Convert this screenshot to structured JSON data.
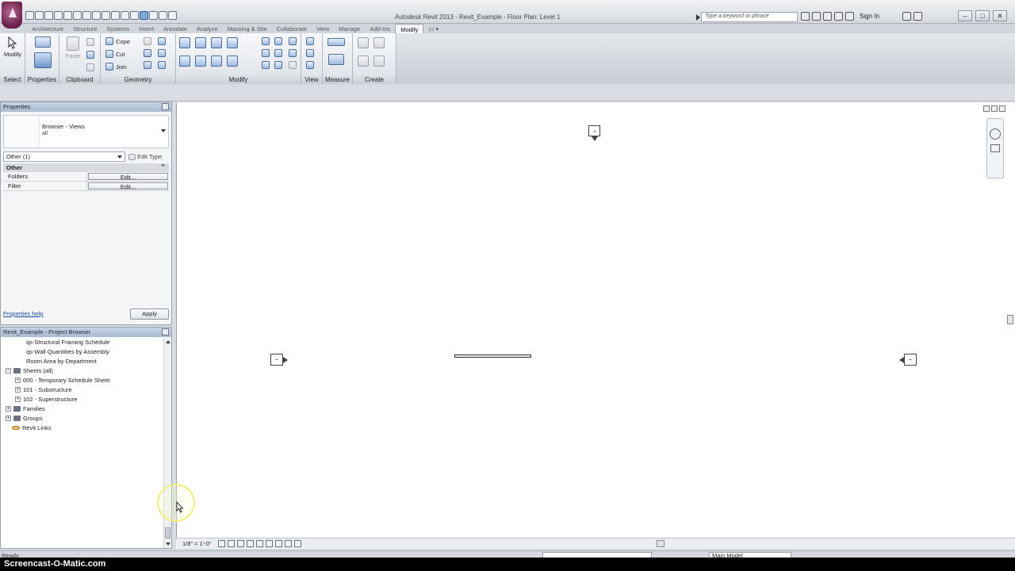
{
  "titlebar": {
    "app_title": "Autodesk Revit 2013",
    "separator": "-",
    "doc_title": "Revit_Example - Floor Plan: Level 1",
    "search_placeholder": "Type a keyword or phrase",
    "sign_in": "Sign In",
    "window_controls": [
      "–",
      "□",
      "✕"
    ]
  },
  "tabs": [
    "Architecture",
    "Structure",
    "Systems",
    "Insert",
    "Annotate",
    "Analyze",
    "Massing & Site",
    "Collaborate",
    "View",
    "Manage",
    "Add-Ins",
    "Modify"
  ],
  "active_tab": "Modify",
  "ribbon": {
    "panels": {
      "select": "Select",
      "properties": "Properties",
      "clipboard": "Clipboard",
      "geometry": "Geometry",
      "modify": "Modify",
      "view": "View",
      "measure": "Measure",
      "create": "Create"
    },
    "buttons": {
      "modify": "Modify",
      "paste": "Paste",
      "cope": "Cope",
      "cut": "Cut",
      "join": "Join"
    }
  },
  "properties": {
    "title": "Properties",
    "type_name": "Browser - Views",
    "type_sub": "all",
    "instance_filter": "Other (1)",
    "edit_type": "Edit Type",
    "group": "Other",
    "rows": [
      {
        "key": "Folders",
        "value": "Edit..."
      },
      {
        "key": "Filter",
        "value": "Edit..."
      }
    ],
    "help_link": "Properties help",
    "apply": "Apply"
  },
  "browser": {
    "title": "Revit_Example - Project Browser",
    "items": [
      {
        "label": "qs-Structural Framing Schedule",
        "kind": "leaf"
      },
      {
        "label": "qs-Wall Quantities by Assembly",
        "kind": "leaf"
      },
      {
        "label": "Room Area by Department",
        "kind": "leaf"
      },
      {
        "label": "Sheets (all)",
        "kind": "folder-open"
      },
      {
        "label": "000 - Temporary Schedule Sheet",
        "kind": "sheet"
      },
      {
        "label": "101 - Substructure",
        "kind": "sheet"
      },
      {
        "label": "102 - Superstructure",
        "kind": "sheet"
      },
      {
        "label": "Families",
        "kind": "folder"
      },
      {
        "label": "Groups",
        "kind": "folder"
      },
      {
        "label": "Revit Links",
        "kind": "links"
      }
    ]
  },
  "viewbar": {
    "scale": "1/8\" = 1'-0\""
  },
  "statusbar": {
    "status": "Ready",
    "model": "Main Model"
  },
  "watermark": "Screencast-O-Matic.com"
}
